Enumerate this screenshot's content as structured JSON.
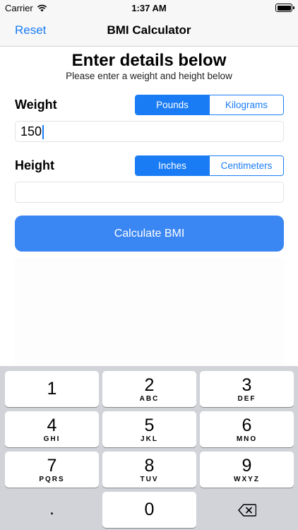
{
  "status_bar": {
    "carrier": "Carrier",
    "time": "1:37 AM"
  },
  "nav": {
    "left_button": "Reset",
    "title": "BMI Calculator"
  },
  "form": {
    "heading": "Enter details below",
    "subheading": "Please enter a weight and height below",
    "weight": {
      "label": "Weight",
      "units": [
        "Pounds",
        "Kilograms"
      ],
      "selected_unit": "Pounds",
      "value": "150",
      "placeholder": ""
    },
    "height": {
      "label": "Height",
      "units": [
        "Inches",
        "Centimeters"
      ],
      "selected_unit": "Inches",
      "value": "",
      "placeholder": ""
    },
    "calculate_label": "Calculate BMI"
  },
  "keyboard": {
    "keys": [
      {
        "num": "1",
        "letters": ""
      },
      {
        "num": "2",
        "letters": "ABC"
      },
      {
        "num": "3",
        "letters": "DEF"
      },
      {
        "num": "4",
        "letters": "GHI"
      },
      {
        "num": "5",
        "letters": "JKL"
      },
      {
        "num": "6",
        "letters": "MNO"
      },
      {
        "num": "7",
        "letters": "PQRS"
      },
      {
        "num": "8",
        "letters": "TUV"
      },
      {
        "num": "9",
        "letters": "WXYZ"
      },
      {
        "num": ".",
        "letters": ""
      },
      {
        "num": "0",
        "letters": ""
      }
    ],
    "delete_icon": "backspace-icon"
  },
  "colors": {
    "accent": "#1a7cf5",
    "button": "#3a86f3",
    "keyboard_bg": "#d1d3d9"
  }
}
